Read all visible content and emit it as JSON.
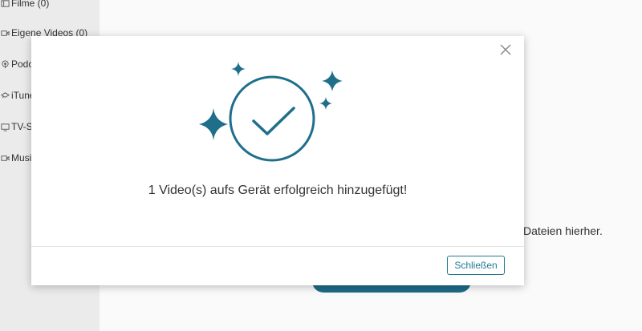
{
  "sidebar": {
    "items": [
      {
        "label": "Filme (0)",
        "icon": "film-icon"
      },
      {
        "label": "Eigene Videos (0)",
        "icon": "video-camera-icon"
      },
      {
        "label": "Podca",
        "icon": "podcast-icon"
      },
      {
        "label": "iTune",
        "icon": "itunes-u-icon"
      },
      {
        "label": "TV-Se",
        "icon": "tv-icon"
      },
      {
        "label": "Musil",
        "icon": "music-video-icon"
      }
    ]
  },
  "main": {
    "hint": "Dateien hierher."
  },
  "dialog": {
    "message": "1 Video(s) aufs Gerät erfolgreich hinzugefügt!",
    "close_button": "Schließen",
    "accent_color": "#1f6f8b"
  }
}
